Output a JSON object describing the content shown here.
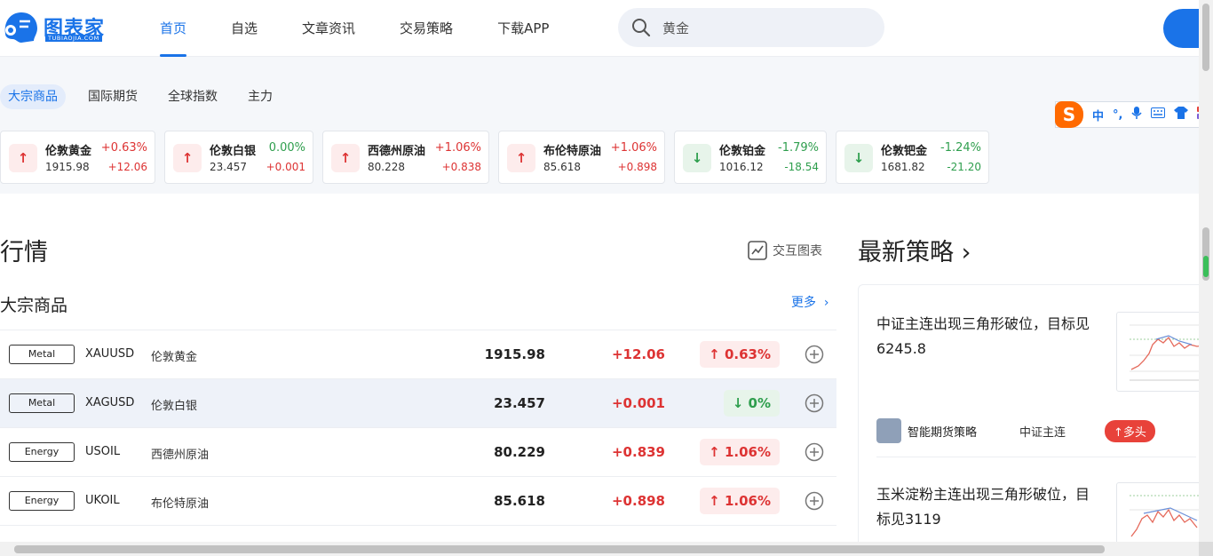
{
  "header": {
    "logo_text": "图表家",
    "logo_sub": "TUBIAOJIA.COM",
    "nav": [
      "首页",
      "自选",
      "文章资讯",
      "交易策略",
      "下载APP"
    ],
    "search_value": "黄金"
  },
  "categories": [
    "大宗商品",
    "国际期货",
    "全球指数",
    "主力"
  ],
  "ime": {
    "logo": "S",
    "items": [
      "中",
      "°,",
      "🎤",
      "⌨",
      "👕",
      "▦"
    ]
  },
  "cards": [
    {
      "name": "伦敦黄金",
      "price": "1915.98",
      "pct": "+0.63%",
      "chg": "+12.06",
      "dir": "up"
    },
    {
      "name": "伦敦白银",
      "price": "23.457",
      "pct": "0.00%",
      "chg": "+0.001",
      "dir": "up"
    },
    {
      "name": "西德州原油",
      "price": "80.228",
      "pct": "+1.06%",
      "chg": "+0.838",
      "dir": "up"
    },
    {
      "name": "布伦特原油",
      "price": "85.618",
      "pct": "+1.06%",
      "chg": "+0.898",
      "dir": "up"
    },
    {
      "name": "伦敦铂金",
      "price": "1016.12",
      "pct": "-1.79%",
      "chg": "-18.54",
      "dir": "down"
    },
    {
      "name": "伦敦钯金",
      "price": "1681.82",
      "pct": "-1.24%",
      "chg": "-21.20",
      "dir": "down"
    }
  ],
  "quotes": {
    "title": "行情",
    "interactive_chart": "交互图表",
    "subtitle": "大宗商品",
    "more": "更多",
    "rows": [
      {
        "tag": "Metal",
        "symbol": "XAUUSD",
        "name": "伦敦黄金",
        "price": "1915.98",
        "change": "+12.06",
        "pct": "↑ 0.63%",
        "dir": "up"
      },
      {
        "tag": "Metal",
        "symbol": "XAGUSD",
        "name": "伦敦白银",
        "price": "23.457",
        "change": "+0.001",
        "pct": "↓ 0%",
        "dir": "down"
      },
      {
        "tag": "Energy",
        "symbol": "USOIL",
        "name": "西德州原油",
        "price": "80.229",
        "change": "+0.839",
        "pct": "↑ 1.06%",
        "dir": "up"
      },
      {
        "tag": "Energy",
        "symbol": "UKOIL",
        "name": "布伦特原油",
        "price": "85.618",
        "change": "+0.898",
        "pct": "↑ 1.06%",
        "dir": "up"
      }
    ]
  },
  "strategies": {
    "title": "最新策略",
    "items": [
      {
        "text": "中证主连出现三角形破位，目标见6245.8",
        "author": "智能期货策略",
        "contract": "中证主连",
        "signal": "↑多头"
      },
      {
        "text": "玉米淀粉主连出现三角形破位，目标见3119",
        "author": "",
        "contract": "",
        "signal": ""
      }
    ]
  },
  "colors": {
    "accent": "#1a73e8",
    "up": "#dd3333",
    "down": "#2e9e4d",
    "bull": "#e8423a"
  }
}
